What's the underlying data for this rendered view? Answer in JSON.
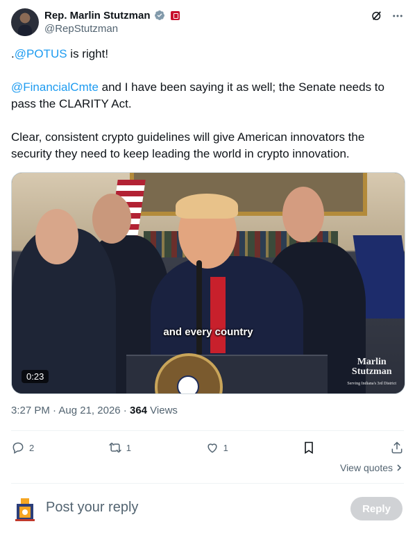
{
  "author": {
    "name": "Rep. Marlin Stutzman",
    "handle": "@RepStutzman"
  },
  "tweet": {
    "p1_prefix": ".",
    "p1_mention": "@POTUS",
    "p1_rest": " is right!",
    "p2_mention": "@FinancialCmte",
    "p2_rest": " and I have been saying it as well; the Senate needs to pass the CLARITY Act.",
    "p3": "Clear, consistent crypto guidelines will give American innovators the security they need to keep leading the world in crypto innovation."
  },
  "media": {
    "caption": "and every country",
    "duration": "0:23",
    "watermark_line1": "Marlin",
    "watermark_line2": "Stutzman",
    "watermark_sub": "Serving Indiana's 3rd District"
  },
  "meta": {
    "time": "3:27 PM",
    "separator": " · ",
    "date": "Aug 21, 2026",
    "views_count": "364",
    "views_label": " Views"
  },
  "actions": {
    "replies": "2",
    "reposts": "1",
    "likes": "1"
  },
  "view_quotes": "View quotes",
  "reply_box": {
    "placeholder": "Post your reply",
    "button": "Reply"
  },
  "colors": {
    "accent": "#1d9bf0",
    "text": "#0f1419",
    "muted": "#536471",
    "reply_disabled": "#d0d2d5"
  },
  "icons": [
    "verified-badge-icon",
    "congress-flag-icon",
    "grok-icon",
    "more-icon",
    "reply-icon",
    "repost-icon",
    "like-icon",
    "bookmark-icon",
    "share-icon",
    "chevron-right-icon"
  ]
}
